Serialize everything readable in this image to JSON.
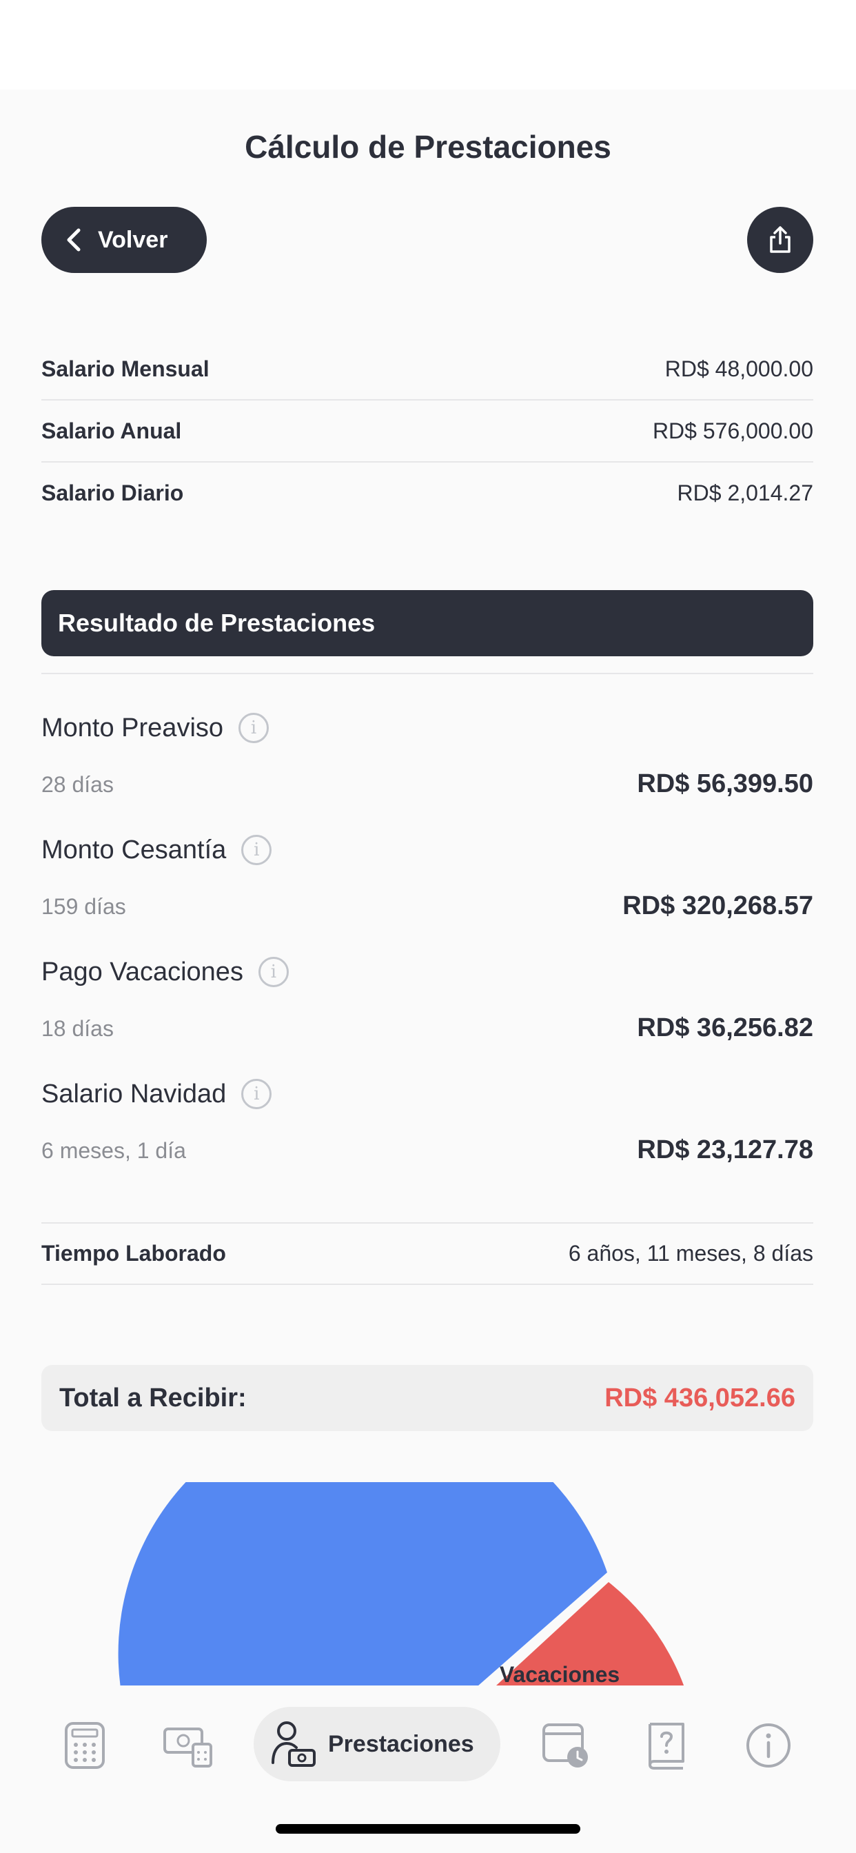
{
  "header": {
    "title": "Cálculo de Prestaciones",
    "back_label": "Volver"
  },
  "salary": [
    {
      "label": "Salario Mensual",
      "value": "RD$ 48,000.00"
    },
    {
      "label": "Salario Anual",
      "value": "RD$ 576,000.00"
    },
    {
      "label": "Salario Diario",
      "value": "RD$ 2,014.27"
    }
  ],
  "results": {
    "header": "Resultado de Prestaciones",
    "items": [
      {
        "title": "Monto Preaviso",
        "sub": "28 días",
        "amount": "RD$ 56,399.50"
      },
      {
        "title": "Monto Cesantía",
        "sub": "159 días",
        "amount": "RD$ 320,268.57"
      },
      {
        "title": "Pago Vacaciones",
        "sub": "18 días",
        "amount": "RD$ 36,256.82"
      },
      {
        "title": "Salario Navidad",
        "sub": "6 meses, 1 día",
        "amount": "RD$ 23,127.78"
      }
    ],
    "info_glyph": "i"
  },
  "tiempo": {
    "label": "Tiempo Laborado",
    "value": "6 años, 11 meses, 8 días"
  },
  "total": {
    "label": "Total a Recibir:",
    "value": "RD$ 436,052.66"
  },
  "chart": {
    "visible_label": "Vacaciones",
    "segments": [
      {
        "name": "Cesantía",
        "value": 320268.57,
        "color": "#5588f2"
      },
      {
        "name": "Vacaciones",
        "value": 36256.82,
        "color": "#e85c58"
      }
    ]
  },
  "tabbar": {
    "active_label": "Prestaciones",
    "icons": [
      "calculator-icon",
      "cash-calculator-icon",
      "person-cash-icon",
      "calendar-clock-icon",
      "help-book-icon",
      "info-icon"
    ]
  },
  "colors": {
    "dark": "#2d303b",
    "accent_red": "#e85c58",
    "chart_blue": "#5588f2",
    "muted": "#8a8c92"
  }
}
